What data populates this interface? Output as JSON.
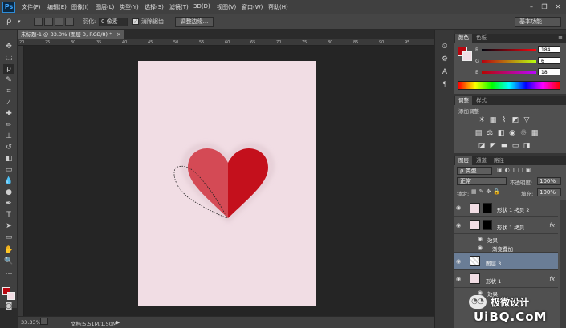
{
  "app": {
    "logo": "Ps"
  },
  "menu": [
    "文件(F)",
    "编辑(E)",
    "图像(I)",
    "图层(L)",
    "类型(Y)",
    "选择(S)",
    "滤镜(T)",
    "3D(D)",
    "视图(V)",
    "窗口(W)",
    "帮助(H)"
  ],
  "window_controls": [
    "–",
    "❐",
    "✕"
  ],
  "options": {
    "feather_label": "羽化:",
    "feather_value": "0 像素",
    "antialias_label": "消除锯齿",
    "refine_edge": "调整边缘...",
    "workspace": "基本功能"
  },
  "document": {
    "tab_title": "未标题-1 @ 33.3% (图层 3, RGB/8) *",
    "close": "×",
    "zoom": "33.33%",
    "doc_info": "文档:5.51M/1.50M"
  },
  "ruler": [
    "20",
    "25",
    "30",
    "35",
    "40",
    "45",
    "50",
    "55",
    "60",
    "65",
    "70",
    "75",
    "80",
    "85",
    "90",
    "95"
  ],
  "color_panel": {
    "tabs": [
      "颜色",
      "色板"
    ],
    "r_label": "R",
    "g_label": "G",
    "b_label": "B",
    "r": "184",
    "g": "6",
    "b": "18",
    "foreground": "#b8060f"
  },
  "adjust_panel": {
    "tabs": [
      "调整",
      "样式"
    ],
    "title": "添加调整"
  },
  "layers_panel": {
    "tabs": [
      "图层",
      "通道",
      "路径"
    ],
    "filter_label": "ρ 类型",
    "blend_mode": "正常",
    "opacity_label": "不透明度:",
    "opacity": "100%",
    "lock_label": "锁定:",
    "fill_label": "填充:",
    "fill": "100%",
    "layers": [
      {
        "name": "形状 1 拷贝 2",
        "fx": ""
      },
      {
        "name": "形状 1 拷贝",
        "fx": "fx"
      },
      {
        "name": "效果",
        "fx": ""
      },
      {
        "name": "渐变叠加",
        "fx": ""
      },
      {
        "name": "图层 3",
        "fx": ""
      },
      {
        "name": "形状 1",
        "fx": "fx"
      },
      {
        "name": "效果",
        "fx": ""
      }
    ]
  },
  "watermark": {
    "brand": "极微设计",
    "site": "UiBQ.CoM"
  },
  "colors": {
    "heart_light": "#d44a55",
    "heart_dark": "#c4101c",
    "paper": "#f1dde4",
    "selected_layer": "#6a7d96"
  }
}
